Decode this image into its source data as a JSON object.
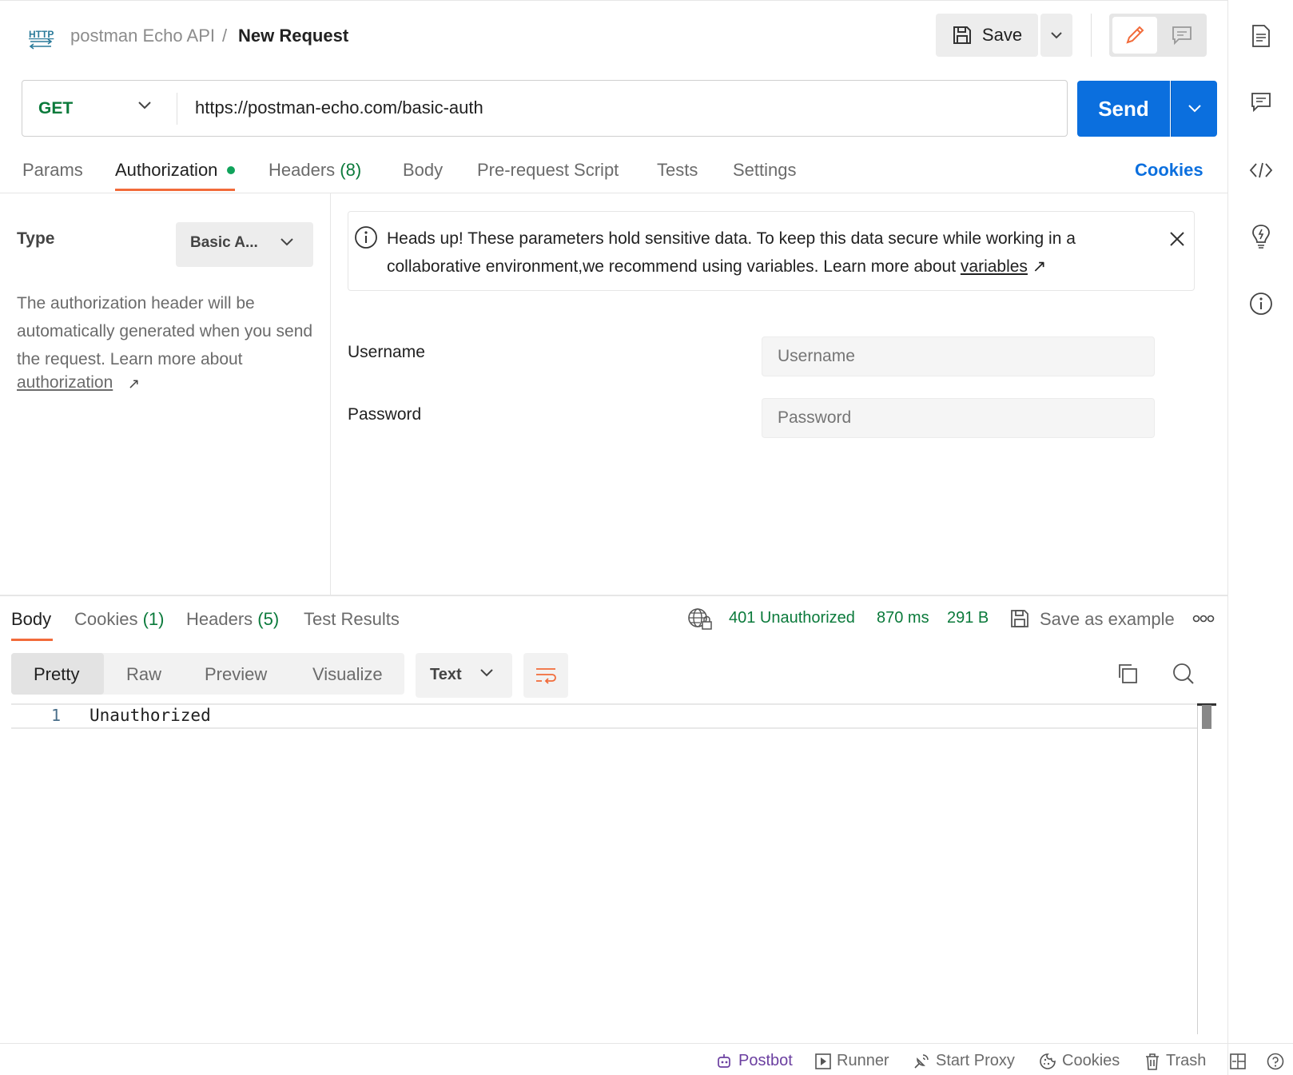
{
  "header": {
    "collection": "postman Echo API",
    "separator": "/",
    "request_name": "New Request",
    "save_label": "Save"
  },
  "request": {
    "method": "GET",
    "url": "https://postman-echo.com/basic-auth",
    "send_label": "Send"
  },
  "tabs": [
    {
      "label": "Params"
    },
    {
      "label": "Authorization"
    },
    {
      "label": "Headers",
      "count": "(8)"
    },
    {
      "label": "Body"
    },
    {
      "label": "Pre-request Script"
    },
    {
      "label": "Tests"
    },
    {
      "label": "Settings"
    }
  ],
  "cookies_link": "Cookies",
  "auth": {
    "type_label": "Type",
    "type_value": "Basic A...",
    "description": "The authorization header will be automatically generated when you send the request. Learn more about",
    "learn_link": "authorization",
    "learn_arrow": "↗",
    "banner_text": "Heads up! These parameters hold sensitive data. To keep this data secure while working in a collaborative environment,we recommend using variables. Learn more about",
    "banner_link": "variables",
    "banner_arrow": "↗",
    "username_label": "Username",
    "username_placeholder": "Username",
    "password_label": "Password",
    "password_placeholder": "Password"
  },
  "response": {
    "tabs": [
      {
        "label": "Body"
      },
      {
        "label": "Cookies",
        "count": "(1)"
      },
      {
        "label": "Headers",
        "count": "(5)"
      },
      {
        "label": "Test Results"
      }
    ],
    "status": "401 Unauthorized",
    "time": "870 ms",
    "size": "291 B",
    "save_example": "Save as example",
    "views": [
      "Pretty",
      "Raw",
      "Preview",
      "Visualize"
    ],
    "format": "Text",
    "lines": [
      {
        "num": "1",
        "text": "Unauthorized"
      }
    ]
  },
  "statusbar": {
    "postbot": "Postbot",
    "runner": "Runner",
    "proxy": "Start Proxy",
    "cookies": "Cookies",
    "trash": "Trash"
  },
  "colors": {
    "accent_orange": "#f26b3a",
    "send_blue": "#0b6fde",
    "success_green": "#0b7a3b",
    "postbot_purple": "#6b3fa0"
  }
}
